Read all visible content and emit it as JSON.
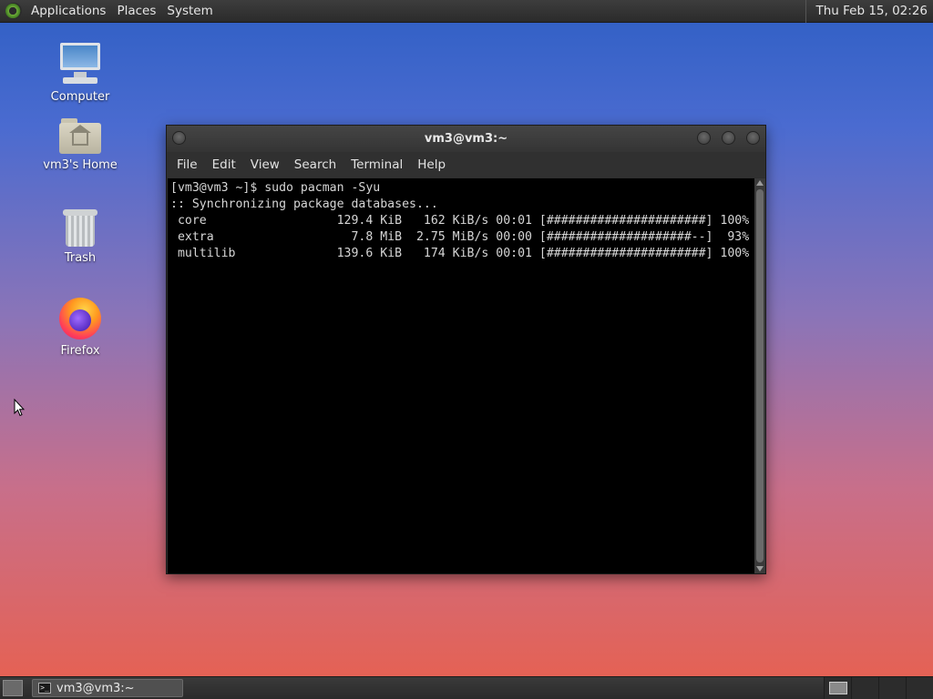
{
  "top_panel": {
    "menus": [
      "Applications",
      "Places",
      "System"
    ],
    "clock": "Thu Feb 15, 02:26"
  },
  "desktop": {
    "icons": [
      {
        "label": "Computer",
        "icon": "computer-icon"
      },
      {
        "label": "vm3's Home",
        "icon": "home-folder-icon"
      },
      {
        "label": "Trash",
        "icon": "trash-icon"
      },
      {
        "label": "Firefox",
        "icon": "firefox-icon"
      }
    ]
  },
  "terminal": {
    "title": "vm3@vm3:~",
    "menus": [
      "File",
      "Edit",
      "View",
      "Search",
      "Terminal",
      "Help"
    ],
    "lines": [
      "[vm3@vm3 ~]$ sudo pacman -Syu",
      ":: Synchronizing package databases...",
      " core                  129.4 KiB   162 KiB/s 00:01 [######################] 100%",
      " extra                   7.8 MiB  2.75 MiB/s 00:00 [####################--]  93%",
      " multilib              139.6 KiB   174 KiB/s 00:01 [######################] 100%"
    ]
  },
  "bottom_panel": {
    "task_label": "vm3@vm3:~",
    "workspaces": 4,
    "active_workspace": 1
  }
}
